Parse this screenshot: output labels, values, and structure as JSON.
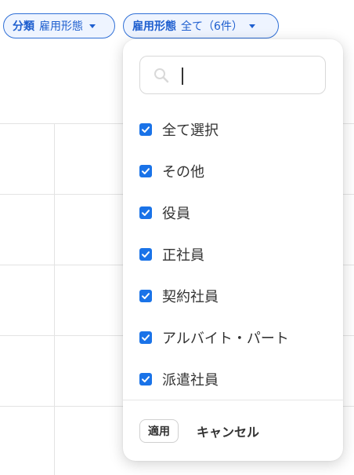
{
  "filters": {
    "category_chip": {
      "label": "分類",
      "value": "雇用形態"
    },
    "employment_chip": {
      "label": "雇用形態",
      "value": "全て（6件）"
    }
  },
  "dropdown": {
    "search": {
      "placeholder": "",
      "value": ""
    },
    "options": [
      {
        "label": "全て選択",
        "checked": true
      },
      {
        "label": "その他",
        "checked": true
      },
      {
        "label": "役員",
        "checked": true
      },
      {
        "label": "正社員",
        "checked": true
      },
      {
        "label": "契約社員",
        "checked": true
      },
      {
        "label": "アルバイト・パート",
        "checked": true
      },
      {
        "label": "派遣社員",
        "checked": true
      }
    ],
    "apply_label": "適用",
    "cancel_label": "キャンセル"
  },
  "colors": {
    "accent": "#1a73e8",
    "chip_border": "#2f6fd6",
    "chip_text": "#1f5fcf"
  }
}
